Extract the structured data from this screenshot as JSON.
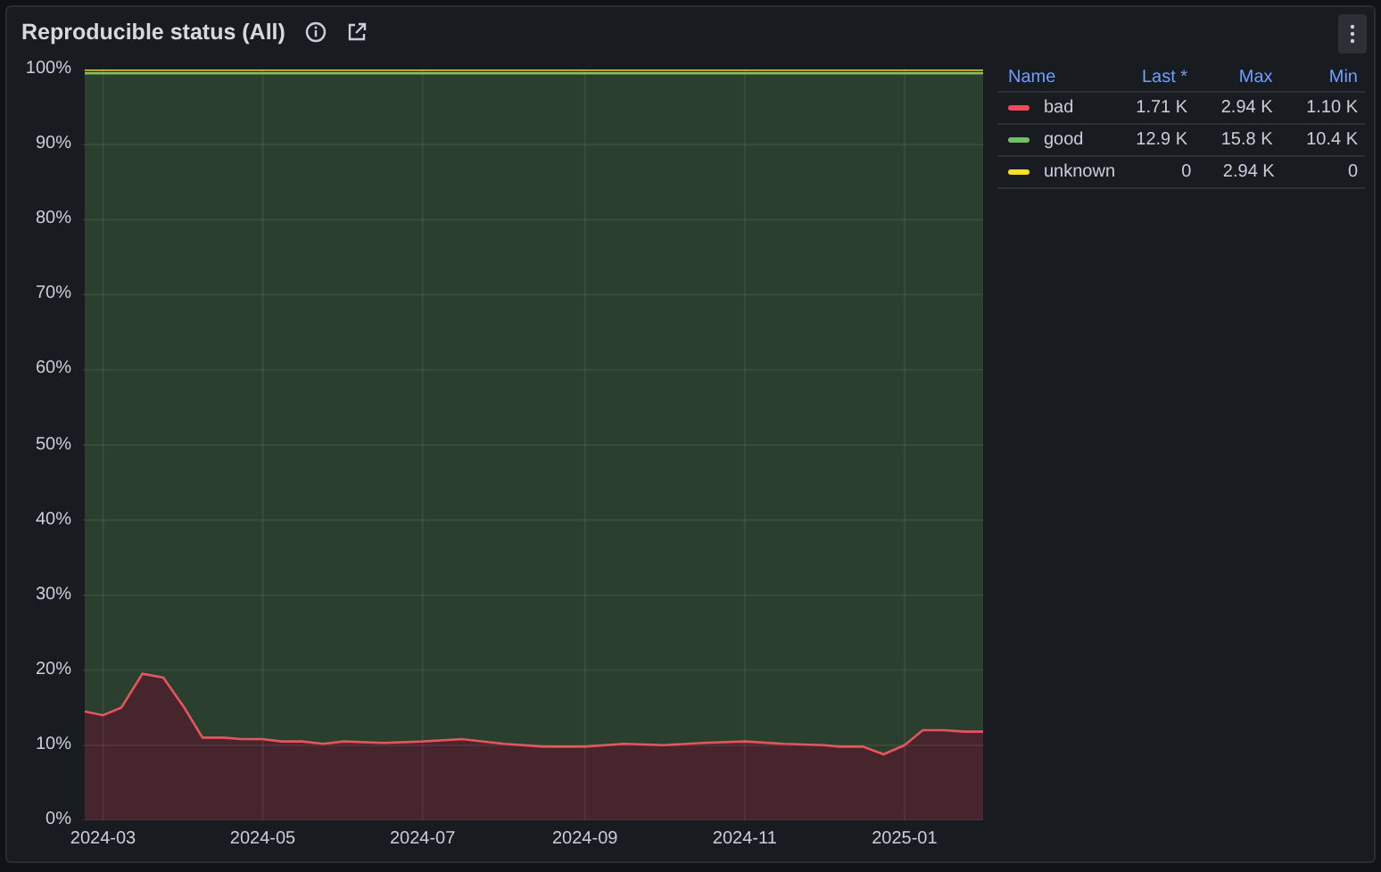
{
  "panel": {
    "title": "Reproducible status (All)"
  },
  "chart_data": {
    "type": "area",
    "stacked": true,
    "grid": true,
    "x": [
      "2024-02-23",
      "2024-03-01",
      "2024-03-08",
      "2024-03-16",
      "2024-03-24",
      "2024-04-01",
      "2024-04-08",
      "2024-04-16",
      "2024-04-23",
      "2024-05-01",
      "2024-05-08",
      "2024-05-16",
      "2024-05-24",
      "2024-06-01",
      "2024-06-16",
      "2024-07-01",
      "2024-07-16",
      "2024-08-01",
      "2024-08-16",
      "2024-09-01",
      "2024-09-16",
      "2024-10-01",
      "2024-10-16",
      "2024-11-01",
      "2024-11-16",
      "2024-12-01",
      "2024-12-07",
      "2024-12-16",
      "2024-12-24",
      "2025-01-01",
      "2025-01-08",
      "2025-01-16",
      "2025-01-24",
      "2025-01-31"
    ],
    "xlim": [
      "2024-02-22",
      "2025-01-31"
    ],
    "xticks": [
      {
        "value": "2024-03-01",
        "label": "2024-03"
      },
      {
        "value": "2024-05-01",
        "label": "2024-05"
      },
      {
        "value": "2024-07-01",
        "label": "2024-07"
      },
      {
        "value": "2024-09-01",
        "label": "2024-09"
      },
      {
        "value": "2024-11-01",
        "label": "2024-11"
      },
      {
        "value": "2025-01-01",
        "label": "2025-01"
      }
    ],
    "ylim": [
      0,
      100
    ],
    "yticks": [
      {
        "value": 0,
        "label": "0%"
      },
      {
        "value": 10,
        "label": "10%"
      },
      {
        "value": 20,
        "label": "20%"
      },
      {
        "value": 30,
        "label": "30%"
      },
      {
        "value": 40,
        "label": "40%"
      },
      {
        "value": 50,
        "label": "50%"
      },
      {
        "value": 60,
        "label": "60%"
      },
      {
        "value": 70,
        "label": "70%"
      },
      {
        "value": 80,
        "label": "80%"
      },
      {
        "value": 90,
        "label": "90%"
      },
      {
        "value": 100,
        "label": "100%"
      }
    ],
    "series": [
      {
        "name": "bad",
        "color": "#f2495c",
        "values": [
          14.5,
          14,
          15,
          19.5,
          19,
          15,
          11,
          11,
          10.8,
          10.8,
          10.5,
          10.5,
          10.2,
          10.5,
          10.3,
          10.5,
          10.8,
          10.2,
          9.8,
          9.8,
          10.2,
          10,
          10.3,
          10.5,
          10.2,
          10,
          9.8,
          9.8,
          8.8,
          10,
          12,
          12,
          11.8,
          11.8
        ]
      },
      {
        "name": "good",
        "color": "#73bf69",
        "values": [
          85,
          85.5,
          84.5,
          80,
          80.5,
          84.5,
          88.5,
          88.5,
          88.7,
          88.7,
          89,
          89,
          89.3,
          89,
          89.2,
          89,
          88.7,
          89.3,
          89.7,
          89.7,
          89.3,
          89.5,
          89.2,
          89,
          89.3,
          89.5,
          89.7,
          89.7,
          90.7,
          89.5,
          87.5,
          87.5,
          87.7,
          87.7
        ]
      },
      {
        "name": "unknown",
        "color": "#fade2a",
        "values": [
          0.5,
          0.5,
          0.5,
          0.5,
          0.5,
          0.5,
          0.5,
          0.5,
          0.5,
          0.5,
          0.5,
          0.5,
          0.5,
          0.5,
          0.5,
          0.5,
          0.5,
          0.5,
          0.5,
          0.5,
          0.5,
          0.5,
          0.5,
          0.5,
          0.5,
          0.5,
          0.5,
          0.5,
          0.5,
          0.5,
          0.5,
          0.5,
          0.5,
          0.5
        ]
      }
    ]
  },
  "legend": {
    "columns": [
      "Name",
      "Last *",
      "Max",
      "Min"
    ],
    "rows": [
      {
        "last": "1.71 K",
        "max": "2.94 K",
        "min": "1.10 K"
      },
      {
        "last": "12.9 K",
        "max": "15.8 K",
        "min": "10.4 K"
      },
      {
        "last": "0",
        "max": "2.94 K",
        "min": "0"
      }
    ]
  }
}
